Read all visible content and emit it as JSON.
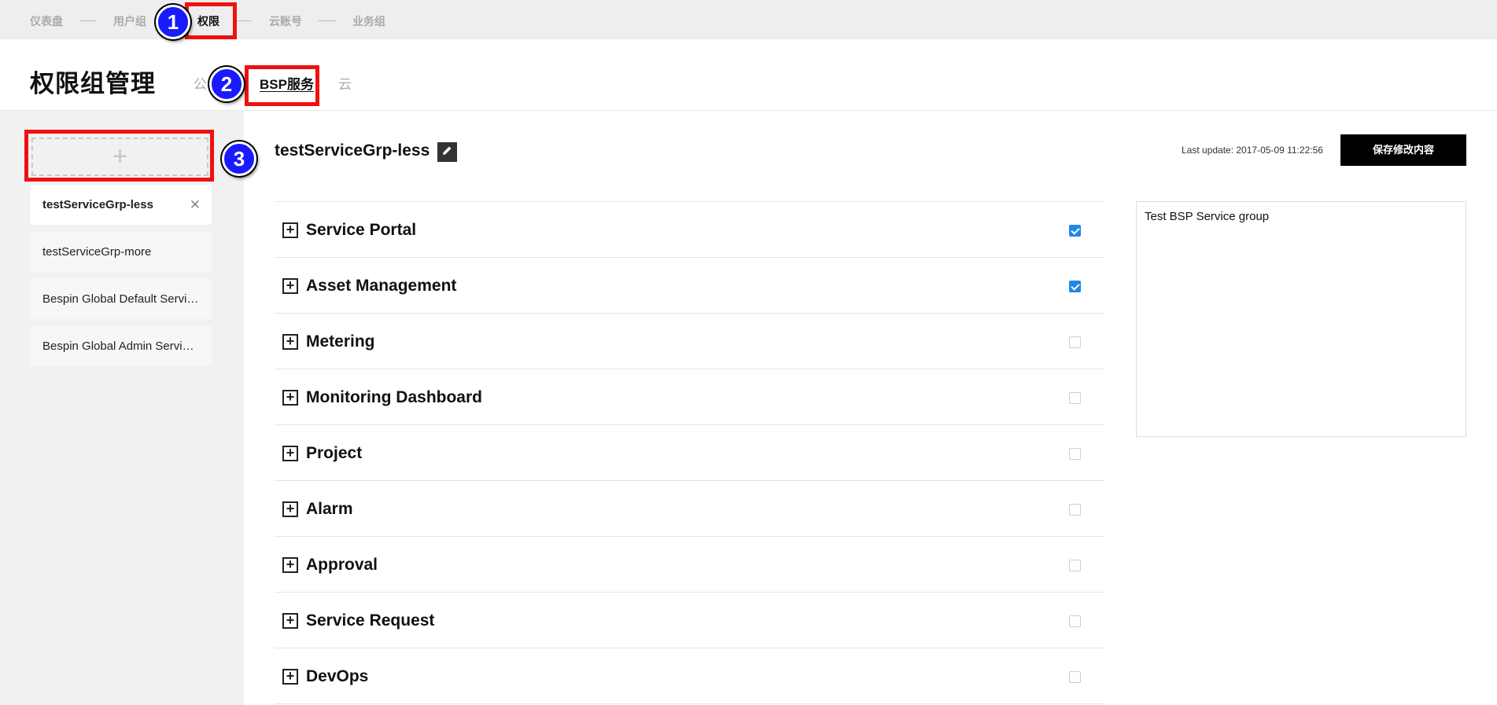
{
  "topnav": {
    "items": [
      {
        "label": "仪表盘"
      },
      {
        "label": "用户组"
      },
      {
        "label": "权限"
      },
      {
        "label": "云账号"
      },
      {
        "label": "业务组"
      }
    ]
  },
  "header": {
    "title": "权限组管理",
    "tabs": [
      {
        "label": "公"
      },
      {
        "label": "BSP服务"
      },
      {
        "label": "云"
      }
    ]
  },
  "sidebar": {
    "add_label": "+",
    "groups": [
      {
        "label": "testServiceGrp-less",
        "close": "✕"
      },
      {
        "label": "testServiceGrp-more"
      },
      {
        "label": "Bespin Global Default Service Group"
      },
      {
        "label": "Bespin Global Admin Service Group"
      }
    ]
  },
  "main": {
    "group_name": "testServiceGrp-less",
    "edit_icon": "pencil-icon",
    "last_update": "Last update: 2017-05-09 11:22:56",
    "save_label": "保存修改内容",
    "description": "Test BSP Service group",
    "permissions": [
      {
        "label": "Service Portal",
        "checked": true
      },
      {
        "label": "Asset Management",
        "checked": true
      },
      {
        "label": "Metering",
        "checked": false
      },
      {
        "label": "Monitoring Dashboard",
        "checked": false
      },
      {
        "label": "Project",
        "checked": false
      },
      {
        "label": "Alarm",
        "checked": false
      },
      {
        "label": "Approval",
        "checked": false
      },
      {
        "label": "Service Request",
        "checked": false
      },
      {
        "label": "DevOps",
        "checked": false
      }
    ]
  },
  "annotations": [
    {
      "number": "1"
    },
    {
      "number": "2"
    },
    {
      "number": "3"
    }
  ],
  "colors": {
    "accent_check": "#1e88e5",
    "annotation_box": "#ee1111",
    "annotation_circle": "#1a1aff"
  }
}
